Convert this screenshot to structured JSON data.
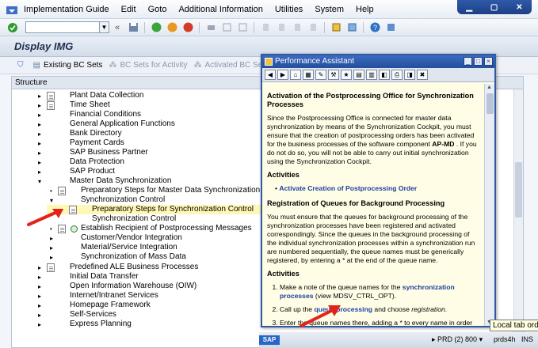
{
  "menubar": {
    "items": [
      "Implementation Guide",
      "Edit",
      "Goto",
      "Additional Information",
      "Utilities",
      "System",
      "Help"
    ]
  },
  "titlebar": {
    "title": "Display IMG"
  },
  "apptoolbar": {
    "existing_bc_sets": "Existing BC Sets",
    "bc_sets_for_activity": "BC Sets for Activity",
    "activated_bc_sets": "Activated BC Sets"
  },
  "tree": {
    "header": "Structure",
    "rows": [
      "Plant Data Collection",
      "Time Sheet",
      "Financial Conditions",
      "General Application Functions",
      "Bank Directory",
      "Payment Cards",
      "SAP Business Partner",
      "Data Protection",
      "SAP Product",
      "Master Data Synchronization",
      "Preparatory Steps for Master Data Synchronization",
      "Synchronization Control",
      "Preparatory Steps for Synchronization Control",
      "Synchronization Control",
      "Establish Recipient of Postprocessing Messages",
      "Customer/Vendor Integration",
      "Material/Service Integration",
      "Synchronization of Mass Data",
      "Predefined ALE Business Processes",
      "Initial Data Transfer",
      "Open Information Warehouse (OIW)",
      "Internet/Intranet Services",
      "Homepage Framework",
      "Self-Services",
      "Express Planning"
    ]
  },
  "pa": {
    "title": "Performance Assistant",
    "h_activation": "Activation of the Postprocessing Office for Synchronization Processes",
    "p_activation_1": "Since the Postprocessing Office is connected for master data synchronization by means of the Synchronization Cockpit, you must ensure that the creation of postprocessing orders has been activated for the business processes of the software component ",
    "p_activation_bold": "AP-MD",
    "p_activation_2": " . If you do not do so, you will not be able to carry out initial synchronization using the Synchronization Cockpit.",
    "h_activities_1": "Activities",
    "link_activate": "Activate Creation of Postprocessing Order",
    "h_registration": "Registration of Queues for Background Processing",
    "p_registration": "You must ensure that the queues for background processing of the synchronization processes have been registered and activated correspondingly. Since the queues in the background processing of the individual synchronization processes within a synchronization run are numbered sequentially, the queue names must be generically registered, by entering a * at the end of the queue name.",
    "h_activities_2": "Activities",
    "step1_a": "Make a note of the queue names for the ",
    "step1_link": "synchronization processes",
    "step1_b": " (view  MDSV_CTRL_OPT).",
    "step2_a": "Call up the ",
    "step2_link": "queue processing",
    "step2_b": " and choose ",
    "step2_em": "registration",
    "step2_c": ".",
    "step3": "Enter the queue names there, adding a * to every name in order to register them generically."
  },
  "status": {
    "logo": "SAP",
    "system": "PRD (2) 800",
    "host": "prds4h",
    "mode": "INS",
    "tooltip": "Local tab order"
  }
}
